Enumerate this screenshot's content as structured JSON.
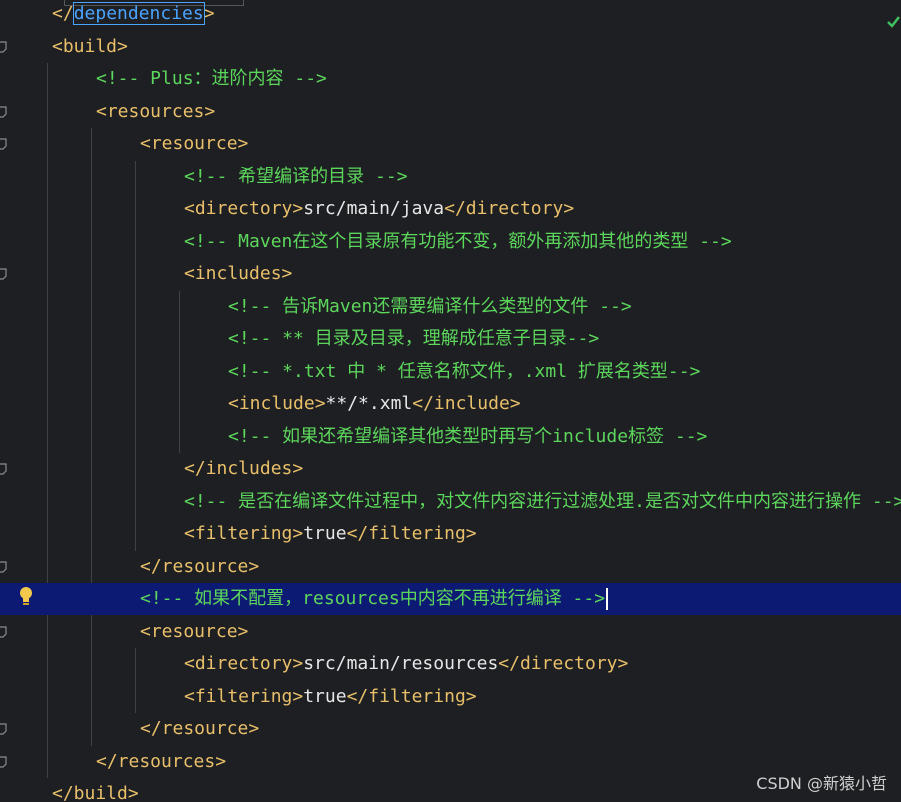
{
  "editor": {
    "lines": [
      {
        "parts": [
          {
            "k": "tag",
            "t": "</"
          },
          {
            "k": "hl",
            "t": "dependencies"
          },
          {
            "k": "tag",
            "t": ">"
          }
        ]
      },
      {
        "parts": [
          {
            "k": "tag",
            "t": "<build>"
          }
        ]
      },
      {
        "parts": [
          {
            "k": "com",
            "t": "<!-- Plus：进阶内容 -->"
          }
        ]
      },
      {
        "parts": [
          {
            "k": "tag",
            "t": "<resources>"
          }
        ]
      },
      {
        "parts": [
          {
            "k": "tag",
            "t": "<resource>"
          }
        ]
      },
      {
        "parts": [
          {
            "k": "com",
            "t": "<!-- 希望编译的目录 -->"
          }
        ]
      },
      {
        "parts": [
          {
            "k": "tag",
            "t": "<directory>"
          },
          {
            "k": "txt",
            "t": "src/main/java"
          },
          {
            "k": "tag",
            "t": "</directory>"
          }
        ]
      },
      {
        "parts": [
          {
            "k": "com",
            "t": "<!-- Maven在这个目录原有功能不变，额外再添加其他的类型 -->"
          }
        ]
      },
      {
        "parts": [
          {
            "k": "tag",
            "t": "<includes>"
          }
        ]
      },
      {
        "parts": [
          {
            "k": "com",
            "t": "<!-- 告诉Maven还需要编译什么类型的文件 -->"
          }
        ]
      },
      {
        "parts": [
          {
            "k": "com",
            "t": "<!-- ** 目录及目录，理解成任意子目录-->"
          }
        ]
      },
      {
        "parts": [
          {
            "k": "com",
            "t": "<!-- *.txt 中 * 任意名称文件，.xml 扩展名类型-->"
          }
        ]
      },
      {
        "parts": [
          {
            "k": "tag",
            "t": "<include>"
          },
          {
            "k": "txt",
            "t": "**/*.xml"
          },
          {
            "k": "tag",
            "t": "</include>"
          }
        ]
      },
      {
        "parts": [
          {
            "k": "com",
            "t": "<!-- 如果还希望编译其他类型时再写个include标签 -->"
          }
        ]
      },
      {
        "parts": [
          {
            "k": "tag",
            "t": "</includes>"
          }
        ]
      },
      {
        "parts": [
          {
            "k": "com",
            "t": "<!-- 是否在编译文件过程中，对文件内容进行过滤处理.是否对文件中内容进行操作 -->"
          }
        ]
      },
      {
        "parts": [
          {
            "k": "tag",
            "t": "<filtering>"
          },
          {
            "k": "txt",
            "t": "true"
          },
          {
            "k": "tag",
            "t": "</filtering>"
          }
        ]
      },
      {
        "parts": [
          {
            "k": "tag",
            "t": "</resource>"
          }
        ]
      },
      {
        "parts": [
          {
            "k": "com",
            "t": "<!-- 如果不配置，resources中内容不再进行编译 -->"
          }
        ]
      },
      {
        "parts": [
          {
            "k": "tag",
            "t": "<resource>"
          }
        ]
      },
      {
        "parts": [
          {
            "k": "tag",
            "t": "<directory>"
          },
          {
            "k": "txt",
            "t": "src/main/resources"
          },
          {
            "k": "tag",
            "t": "</directory>"
          }
        ]
      },
      {
        "parts": [
          {
            "k": "tag",
            "t": "<filtering>"
          },
          {
            "k": "txt",
            "t": "true"
          },
          {
            "k": "tag",
            "t": "</filtering>"
          }
        ]
      },
      {
        "parts": [
          {
            "k": "tag",
            "t": "</resource>"
          }
        ]
      },
      {
        "parts": [
          {
            "k": "tag",
            "t": "</resources>"
          }
        ]
      },
      {
        "parts": [
          {
            "k": "tag",
            "t": "</build>"
          }
        ]
      }
    ],
    "current_line": 18,
    "gutter_icons": [
      "fold-marker-icon",
      "lightbulb-icon"
    ],
    "status_icon": "inspection-ok-check-icon"
  },
  "watermark": "CSDN @新猿小哲",
  "colors": {
    "background": "#1e1f22",
    "tag": "#e8bf6a",
    "comment": "#5cd65c",
    "text": "#e6e6e6",
    "highlight": "#4aa3ff",
    "current_line": "#0d1a73"
  }
}
